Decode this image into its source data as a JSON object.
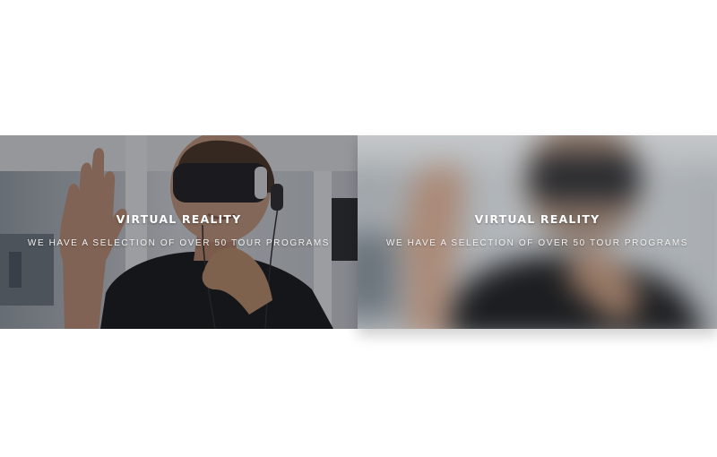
{
  "banners": [
    {
      "title": "VIRTUAL REALITY",
      "subtitle": "WE HAVE A SELECTION OF OVER 50 TOUR PROGRAMS",
      "state": "sharp"
    },
    {
      "title": "VIRTUAL REALITY",
      "subtitle": "WE HAVE A SELECTION OF OVER 50 TOUR PROGRAMS",
      "state": "blurred"
    }
  ],
  "colors": {
    "background": "#ffffff",
    "caption_text": "#ffffff",
    "shirt": "#15161a",
    "headset": "#1c1d21",
    "skin": "#c99a7e",
    "office_bg": "#cfd4da"
  }
}
